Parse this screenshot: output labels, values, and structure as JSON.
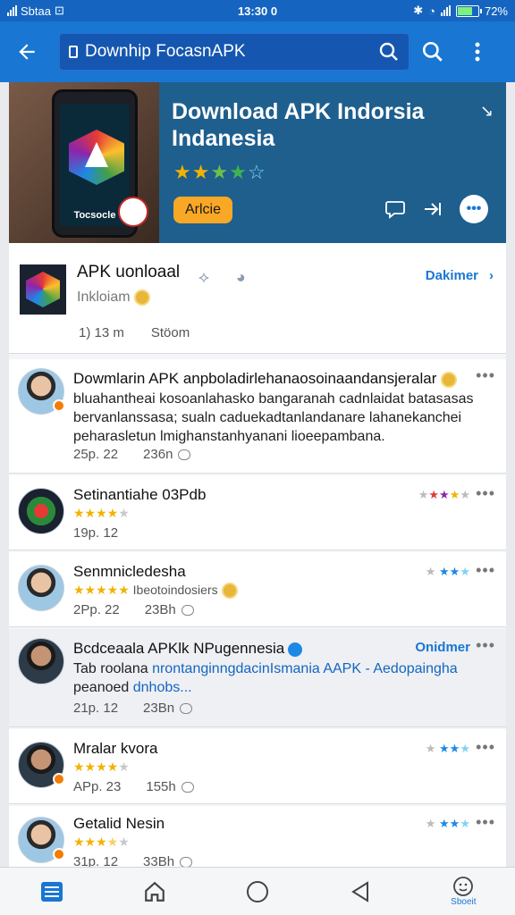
{
  "status_bar": {
    "left": "Sbtaa",
    "time": "13:30 0",
    "battery": "72%",
    "battery_level": 0.72
  },
  "app_bar": {
    "search_text": "Downhip FocasnAPK",
    "icons": [
      "back-arrow-icon",
      "search-icon",
      "search-icon",
      "more-vert-icon"
    ]
  },
  "hero": {
    "title": "Download APK Indorsia Indanesia",
    "rating": 4.5,
    "button_label": "Arlcie",
    "phone_label": "Tocsocle"
  },
  "app_card": {
    "name": "APK uonloaal",
    "subtitle": "Inkloiam",
    "link_label": "Dakimer",
    "meta_count": "1) 13 m",
    "meta_size": "Stöom"
  },
  "posts": [
    {
      "title": "Dowmlarin APK anpboladirlehanaosoinaandansjeralar",
      "body": "bluahantheai kosoanlahasko bangaranah cadnlaidat batasasas bervanlanssasa; sualn caduekadtanlandanare lahanekanchei peharasletun lmighanstanhyanani lioeepambana.",
      "date": "25p. 22",
      "comments": "236n"
    },
    {
      "title": "Setinantiahe 03Pdb",
      "rating": 4,
      "date": "19p. 12"
    },
    {
      "title": "Senmnicledesha",
      "rating": 5,
      "subtitle": "Ibeotoindosiers",
      "date": "2Pp. 22",
      "comments": "23Bh"
    },
    {
      "title": "Bcdceaala APKlk NPugennesia",
      "link_label": "Onidmer",
      "body_prefix": "Tab roolana",
      "body_link": "nrontanginngdacinIsmania AAPK - Aedopaingha",
      "body_suffix": "peanoed",
      "body_suffix_link": "dnhobs...",
      "date": "21p. 12",
      "comments": "23Bn"
    },
    {
      "title": "Mralar kvora",
      "rating": 4,
      "date": "APp. 23",
      "comments": "155h"
    },
    {
      "title": "Getalid Nesin",
      "rating": 3.5,
      "date": "31p. 12",
      "comments": "33Bh"
    }
  ],
  "bottom_nav": {
    "items": [
      "menu-icon",
      "home-icon",
      "circle-home-icon",
      "back-triangle-icon",
      "emoji-icon"
    ],
    "last_label": "Sboeit"
  },
  "colors": {
    "primary": "#1976d2",
    "primary_dark": "#1565c0",
    "hero_bg": "#1e5f8e",
    "accent": "#f9a825"
  }
}
